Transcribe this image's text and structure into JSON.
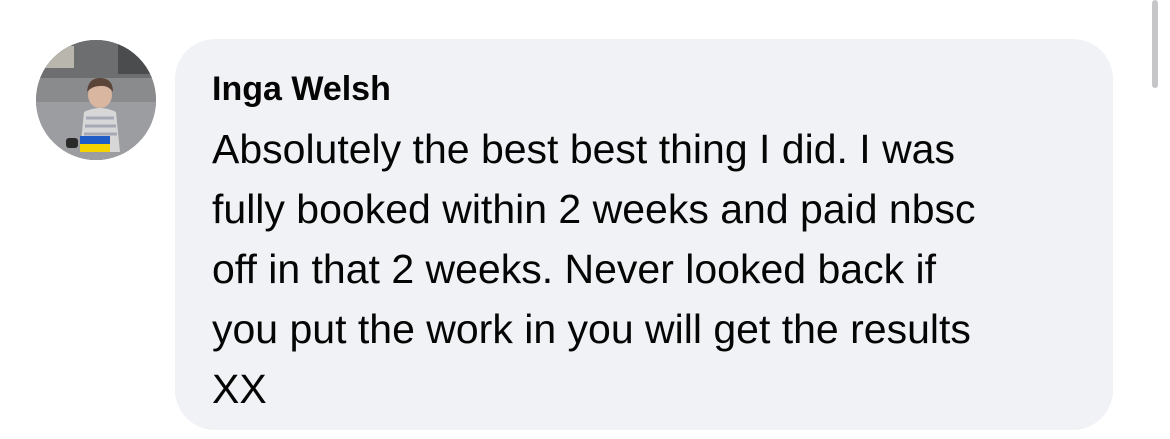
{
  "comment": {
    "author": "Inga Welsh",
    "text": "Absolutely the best best thing I did. I was\nfully booked within 2 weeks and paid nbsc\noff in that 2 weeks.  Never looked back if\nyou put the work in you will get the results\nXX"
  },
  "colors": {
    "bubble_background": "#f0f2f5",
    "text": "#050505",
    "flag_blue": "#1f5cc5",
    "flag_yellow": "#f4d300"
  },
  "icons": {
    "avatar": "profile-photo-icon"
  }
}
